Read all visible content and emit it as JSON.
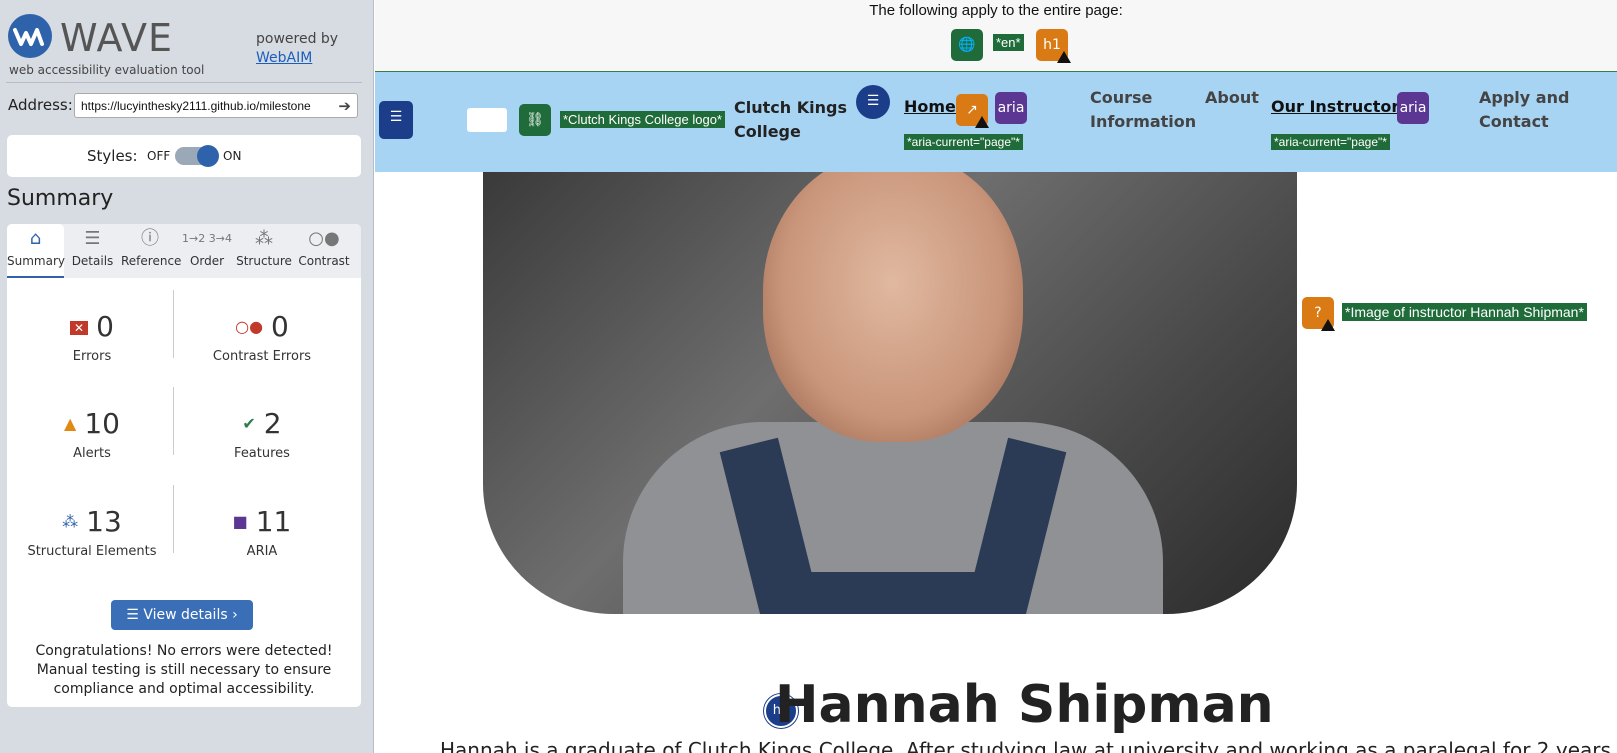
{
  "sidebar": {
    "brand": "WAVE",
    "tagline": "web accessibility evaluation tool",
    "powered_by": "powered by",
    "webaim_link": "WebAIM",
    "address_label": "Address:",
    "address_value": "https://lucyinthesky2111.github.io/milestone",
    "styles_label": "Styles:",
    "styles_off": "OFF",
    "styles_on": "ON",
    "summary_title": "Summary",
    "tabs": [
      {
        "label": "Summary",
        "icon": "home-icon"
      },
      {
        "label": "Details",
        "icon": "list-icon"
      },
      {
        "label": "Reference",
        "icon": "info-icon"
      },
      {
        "label": "Order",
        "icon": "order-icon"
      },
      {
        "label": "Structure",
        "icon": "structure-icon"
      },
      {
        "label": "Contrast",
        "icon": "contrast-icon"
      }
    ],
    "stats": {
      "errors": {
        "value": "0",
        "label": "Errors"
      },
      "contrast_errors": {
        "value": "0",
        "label": "Contrast Errors"
      },
      "alerts": {
        "value": "10",
        "label": "Alerts"
      },
      "features": {
        "value": "2",
        "label": "Features"
      },
      "structural": {
        "value": "13",
        "label": "Structural Elements"
      },
      "aria": {
        "value": "11",
        "label": "ARIA"
      }
    },
    "view_details": "View details ›",
    "congrats": "Congratulations! No errors were detected! Manual testing is still necessary to ensure compliance and optimal accessibility."
  },
  "page": {
    "top_note": "The following apply to the entire page:",
    "lang_tag": "*en*",
    "h1_badge": "h1",
    "logo_alt": "*Clutch Kings College logo*",
    "site_title": "Clutch Kings College",
    "nav": {
      "home": "Home",
      "course_info": "Course Information",
      "about": "About",
      "instructors": "Our Instructors",
      "apply": "Apply and Contact",
      "aria_current": "*aria-current=\"page\"*",
      "aria_badge": "aria"
    },
    "image_alt": "*Image of instructor Hannah Shipman*",
    "heading_badge": "h2",
    "instructor_name": "Hannah Shipman",
    "bio": "Hannah is a graduate of Clutch Kings College. After studying law at university and working as a paralegal for 2 years"
  },
  "colors": {
    "accent": "#2e63ab",
    "nav_bg": "#a8d4f4",
    "feature_green": "#1f6b3a",
    "alert_orange": "#d97a14",
    "aria_purple": "#5b3692"
  }
}
